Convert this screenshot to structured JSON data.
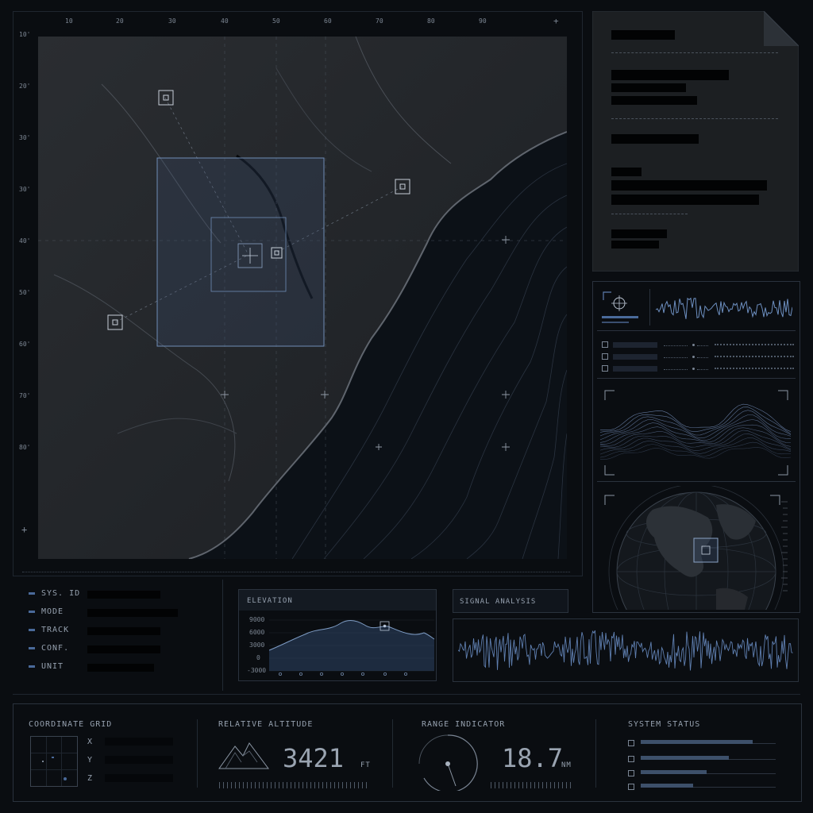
{
  "map": {
    "x_ticks": [
      "10",
      "20",
      "30",
      "40",
      "50",
      "60",
      "70",
      "80",
      "90"
    ],
    "y_ticks": [
      "10'",
      "20'",
      "30'",
      "30'",
      "40'",
      "50'",
      "60'",
      "70'",
      "80'"
    ]
  },
  "info_rows": [
    {
      "label": "SYS. ID"
    },
    {
      "label": "MODE"
    },
    {
      "label": "TRACK"
    },
    {
      "label": "CONF."
    },
    {
      "label": "UNIT"
    }
  ],
  "elevation": {
    "title": "ELEVATION",
    "y_ticks": [
      "9000",
      "6000",
      "3000",
      "0",
      "-3000"
    ]
  },
  "signal": {
    "title": "SIGNAL ANALYSIS"
  },
  "bottom": {
    "coord_title": "COORDINATE GRID",
    "axes": [
      "X",
      "Y",
      "Z"
    ],
    "alt_title": "RELATIVE ALTITUDE",
    "alt_value": "3421",
    "alt_unit": "FT",
    "range_title": "RANGE INDICATOR",
    "range_value": "18.7",
    "range_unit": "NM",
    "status_title": "SYSTEM STATUS",
    "status_levels": [
      0.83,
      0.65,
      0.49,
      0.39
    ]
  },
  "colors": {
    "accent": "#4a6a9a",
    "panel_border": "#2a323d",
    "redaction": "#020304"
  }
}
